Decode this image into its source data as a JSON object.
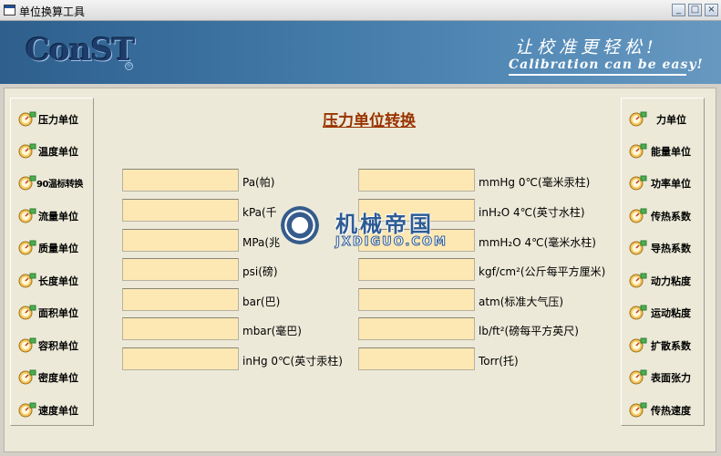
{
  "window": {
    "title": "单位换算工具",
    "minimize_icon": "minimize-icon",
    "maximize_icon": "maximize-icon",
    "close_icon": "close-icon"
  },
  "banner": {
    "logo": "ConST",
    "slogan_cn": "让校准更轻松!",
    "slogan_en": "Calibration can be easy!"
  },
  "heading": "压力单位转换",
  "left_nav": [
    {
      "label": "压力单位",
      "icon": "gauge-icon"
    },
    {
      "label": "温度单位",
      "icon": "gauge-icon"
    },
    {
      "label": "90温标转换",
      "icon": "gauge-icon"
    },
    {
      "label": "流量单位",
      "icon": "gauge-icon"
    },
    {
      "label": "质量单位",
      "icon": "gauge-icon"
    },
    {
      "label": "长度单位",
      "icon": "gauge-icon"
    },
    {
      "label": "面积单位",
      "icon": "gauge-icon"
    },
    {
      "label": "容积单位",
      "icon": "gauge-icon"
    },
    {
      "label": "密度单位",
      "icon": "gauge-icon"
    },
    {
      "label": "速度单位",
      "icon": "gauge-icon"
    }
  ],
  "right_nav": [
    {
      "label": "力单位",
      "icon": "gauge-icon"
    },
    {
      "label": "能量单位",
      "icon": "gauge-icon"
    },
    {
      "label": "功率单位",
      "icon": "gauge-icon"
    },
    {
      "label": "传热系数",
      "icon": "gauge-icon"
    },
    {
      "label": "导热系数",
      "icon": "gauge-icon"
    },
    {
      "label": "动力粘度",
      "icon": "gauge-icon"
    },
    {
      "label": "运动粘度",
      "icon": "gauge-icon"
    },
    {
      "label": "扩散系数",
      "icon": "gauge-icon"
    },
    {
      "label": "表面张力",
      "icon": "gauge-icon"
    },
    {
      "label": "传热速度",
      "icon": "gauge-icon"
    }
  ],
  "left_units": [
    {
      "label": "Pa(帕)",
      "value": ""
    },
    {
      "label": "kPa(千",
      "value": ""
    },
    {
      "label": "MPa(兆",
      "value": ""
    },
    {
      "label": "psi(磅)",
      "value": ""
    },
    {
      "label": "bar(巴)",
      "value": ""
    },
    {
      "label": "mbar(毫巴)",
      "value": ""
    },
    {
      "label": "inHg 0℃(英寸汞柱)",
      "value": ""
    }
  ],
  "right_units": [
    {
      "label": "mmHg 0℃(毫米汞柱)",
      "value": ""
    },
    {
      "label": "inH₂O 4℃(英寸水柱)",
      "value": ""
    },
    {
      "label": "mmH₂O 4℃(毫米水柱)",
      "value": ""
    },
    {
      "label": "kgf/cm²(公斤每平方厘米)",
      "value": ""
    },
    {
      "label": "atm(标准大气压)",
      "value": ""
    },
    {
      "label": "lb/ft²(磅每平方英尺)",
      "value": ""
    },
    {
      "label": "Torr(托)",
      "value": ""
    }
  ],
  "watermark": {
    "text": "机械帝国",
    "sub": "JXDIGUO.COM"
  }
}
